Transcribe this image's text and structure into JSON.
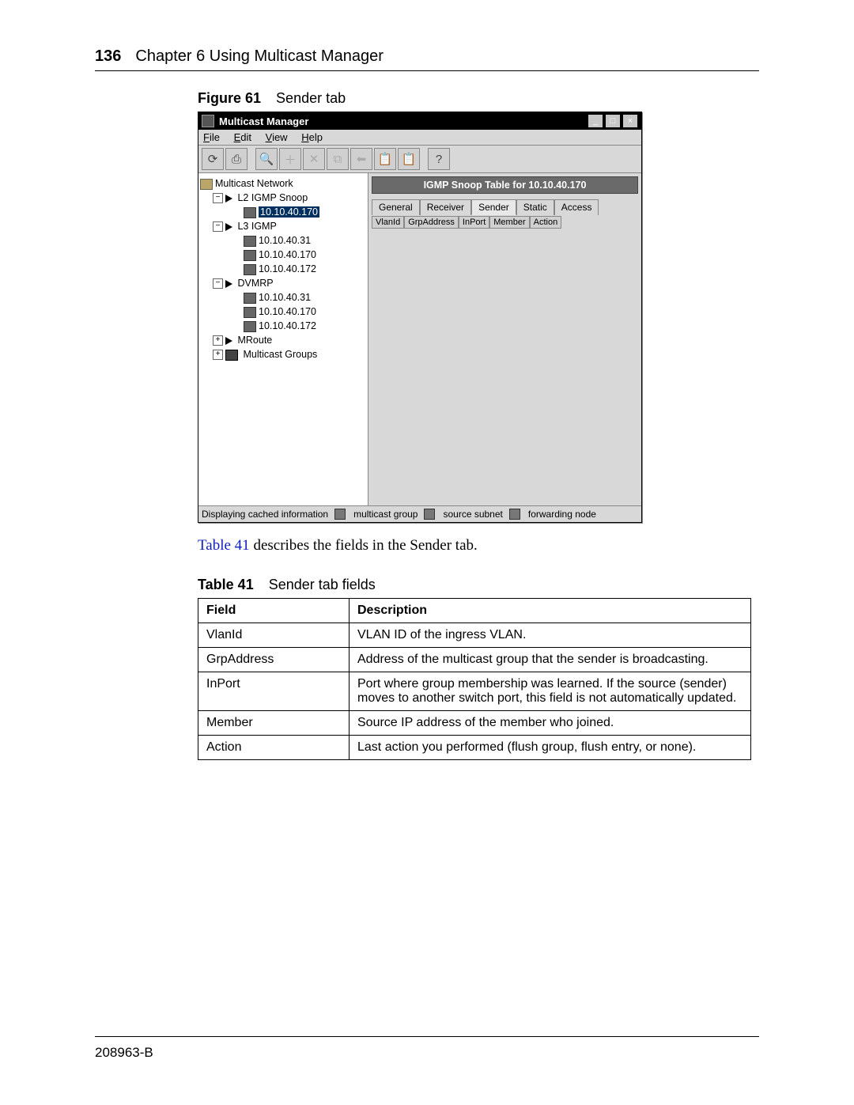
{
  "pageHeader": {
    "pageNumber": "136",
    "chapter": "Chapter 6  Using Multicast Manager"
  },
  "figure": {
    "label": "Figure 61",
    "caption": "Sender tab"
  },
  "bodyText": {
    "xref": "Table 41",
    "rest": " describes the fields in the Sender tab."
  },
  "tableCaption": {
    "label": "Table 41",
    "caption": "Sender tab fields"
  },
  "fieldsTable": {
    "headers": [
      "Field",
      "Description"
    ],
    "rows": [
      {
        "field": "VlanId",
        "desc": "VLAN ID of the ingress VLAN."
      },
      {
        "field": "GrpAddress",
        "desc": "Address of the multicast group that the sender is broadcasting."
      },
      {
        "field": "InPort",
        "desc": "Port where group membership was learned. If the source (sender) moves to another switch port, this field is not automatically updated."
      },
      {
        "field": "Member",
        "desc": "Source IP address of the member who joined."
      },
      {
        "field": "Action",
        "desc": "Last action you performed (flush group, flush entry, or none)."
      }
    ]
  },
  "docId": "208963-B",
  "app": {
    "title": "Multicast Manager",
    "menu": {
      "file": "File",
      "edit": "Edit",
      "view": "View",
      "help": "Help"
    },
    "panelTitle": "IGMP Snoop Table for 10.10.40.170",
    "tabs": [
      "General",
      "Receiver",
      "Sender",
      "Static",
      "Access"
    ],
    "columns": [
      "VlanId",
      "GrpAddress",
      "InPort",
      "Member",
      "Action"
    ],
    "status": {
      "msg": "Displaying cached information",
      "leg1": "multicast group",
      "leg2": "source subnet",
      "leg3": "forwarding node"
    },
    "tree": {
      "root": "Multicast Network",
      "n1": "L2 IGMP Snoop",
      "n1a": "10.10.40.170",
      "n2": "L3 IGMP",
      "n2a": "10.10.40.31",
      "n2b": "10.10.40.170",
      "n2c": "10.10.40.172",
      "n3": "DVMRP",
      "n3a": "10.10.40.31",
      "n3b": "10.10.40.170",
      "n3c": "10.10.40.172",
      "n4": "MRoute",
      "n5": "Multicast Groups"
    }
  }
}
